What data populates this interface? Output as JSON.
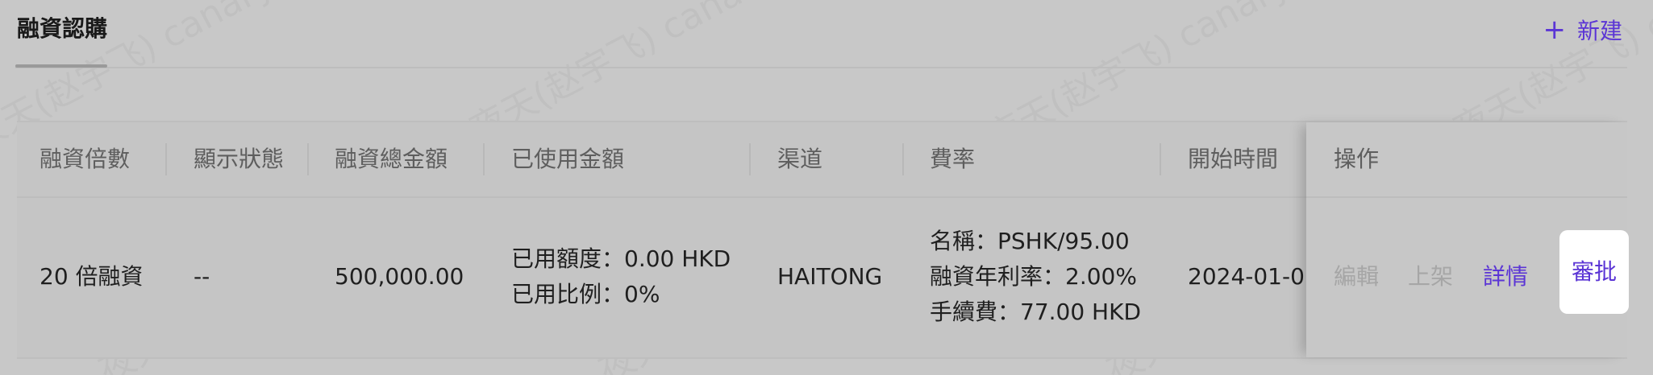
{
  "header": {
    "tab_title": "融資認購",
    "new_button_label": "新建"
  },
  "table": {
    "columns": [
      "融資倍數",
      "顯示狀態",
      "融資總金額",
      "已使用金額",
      "渠道",
      "費率",
      "開始時間",
      "操作"
    ],
    "rows": [
      {
        "leverage": "20 倍融資",
        "display_status": "--",
        "total_amount": "500,000.00",
        "used": {
          "line1": "已用額度：0.00 HKD",
          "line2": "已用比例：0%"
        },
        "channel": "HAITONG",
        "rate": {
          "line1": "名稱：PSHK/95.00",
          "line2": "融資年利率：2.00%",
          "line3": "手續費：77.00 HKD"
        },
        "start_time": "2024-01-0",
        "actions": {
          "edit": "編輯",
          "publish": "上架",
          "details": "詳情",
          "approve": "審批"
        }
      }
    ]
  },
  "watermark_text": "夜天(赵宇飞) canary",
  "colors": {
    "accent": "#5b35d5",
    "background": "#c8c8c8",
    "disabled": "#a6a6a6"
  }
}
